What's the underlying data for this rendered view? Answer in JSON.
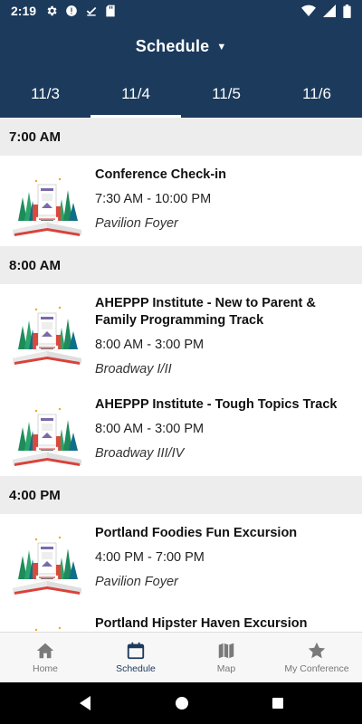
{
  "status_bar": {
    "time": "2:19",
    "left_icons": [
      "gear-icon",
      "alert-icon",
      "download-done-icon",
      "sd-card-icon"
    ],
    "right_icons": [
      "wifi-icon",
      "signal-icon",
      "battery-icon"
    ]
  },
  "header": {
    "title": "Schedule",
    "dropdown_icon": "caret-down-icon",
    "caret": "▼"
  },
  "tabs": [
    {
      "label": "11/3",
      "active": false
    },
    {
      "label": "11/4",
      "active": true
    },
    {
      "label": "11/5",
      "active": false
    },
    {
      "label": "11/6",
      "active": false
    }
  ],
  "groups": [
    {
      "time": "7:00 AM",
      "sessions": [
        {
          "title": "Conference Check-in",
          "time": "7:30 AM - 10:00 PM",
          "location": "Pavilion Foyer"
        }
      ]
    },
    {
      "time": "8:00 AM",
      "sessions": [
        {
          "title": "AHEPPP Institute - New to Parent & Family Programming Track",
          "time": "8:00 AM - 3:00 PM",
          "location": "Broadway I/II"
        },
        {
          "title": "AHEPPP Institute - Tough Topics Track",
          "time": "8:00 AM - 3:00 PM",
          "location": "Broadway III/IV"
        }
      ]
    },
    {
      "time": "4:00 PM",
      "sessions": [
        {
          "title": "Portland Foodies Fun Excursion",
          "time": "4:00 PM - 7:00 PM",
          "location": "Pavilion Foyer"
        },
        {
          "title": "Portland Hipster Haven Excursion",
          "time": "",
          "location": ""
        }
      ]
    }
  ],
  "bottom_nav": [
    {
      "label": "Home",
      "icon": "home-icon",
      "active": false
    },
    {
      "label": "Schedule",
      "icon": "calendar-icon",
      "active": true
    },
    {
      "label": "Map",
      "icon": "map-icon",
      "active": false
    },
    {
      "label": "My Conference",
      "icon": "star-icon",
      "active": false
    }
  ],
  "system_nav": [
    "back-icon",
    "home-circle-icon",
    "recents-icon"
  ],
  "colors": {
    "primary": "#1b3a5c",
    "section_bg": "#ededed",
    "active_nav": "#1b3a5c",
    "inactive_nav": "#777777"
  }
}
